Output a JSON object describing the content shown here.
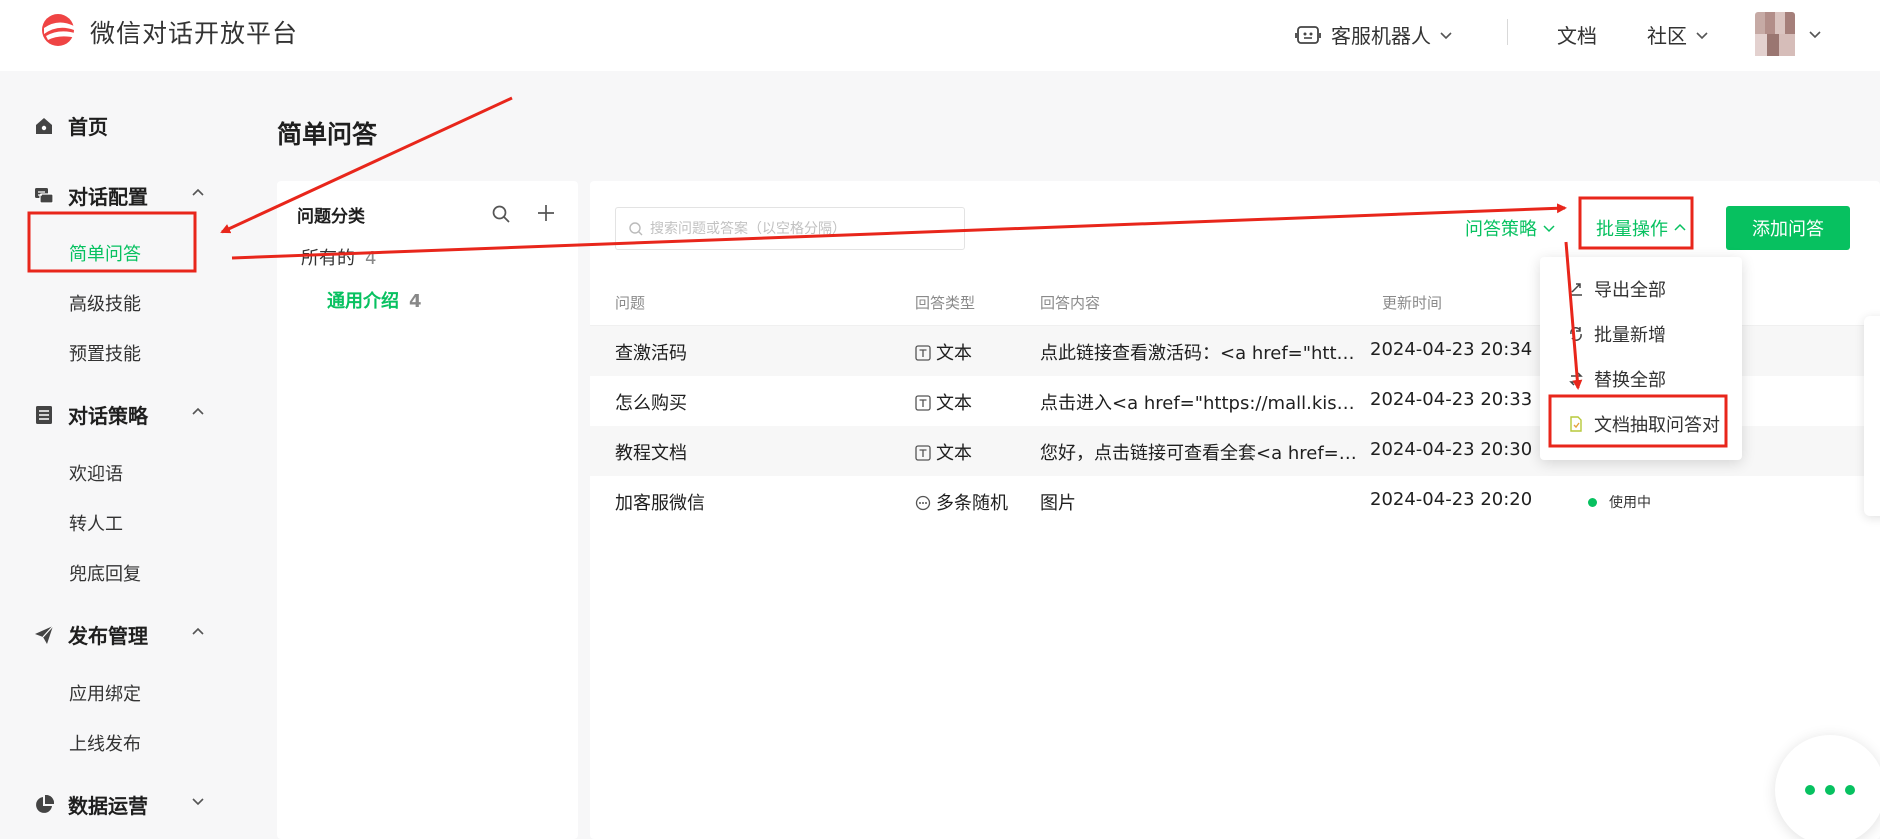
{
  "header": {
    "brand": "微信对话开放平台",
    "bot_menu": "客服机器人",
    "docs": "文档",
    "community": "社区"
  },
  "sidebar": {
    "home": "首页",
    "dialog_config": {
      "label": "对话配置",
      "items": [
        "简单问答",
        "高级技能",
        "预置技能"
      ]
    },
    "dialog_strategy": {
      "label": "对话策略",
      "items": [
        "欢迎语",
        "转人工",
        "兜底回复"
      ]
    },
    "publish": {
      "label": "发布管理",
      "items": [
        "应用绑定",
        "上线发布"
      ]
    },
    "data_ops": {
      "label": "数据运营"
    }
  },
  "page_title": "简单问答",
  "categories": {
    "title": "问题分类",
    "all_label": "所有的",
    "all_count": "4",
    "items": [
      {
        "label": "通用介绍",
        "count": "4"
      }
    ]
  },
  "toolbar": {
    "search_placeholder": "搜索问题或答案（以空格分隔）",
    "strategy": "问答策略",
    "batch": "批量操作",
    "add": "添加问答"
  },
  "table": {
    "headers": [
      "问题",
      "回答类型",
      "回答内容",
      "更新时间"
    ],
    "rows": [
      {
        "question": "查激活码",
        "type": "文本",
        "content": "点此链接查看激活码：<a href=\"https...",
        "time": "2024-04-23 20:34"
      },
      {
        "question": "怎么购买",
        "type": "文本",
        "content": "点击进入<a href=\"https://mall.kissfr...",
        "time": "2024-04-23 20:33"
      },
      {
        "question": "教程文档",
        "type": "文本",
        "content": "您好，点击链接可查看全套<a href=\"...",
        "time": "2024-04-23 20:30"
      },
      {
        "question": "加客服微信",
        "type": "多条随机",
        "content": "图片",
        "time": "2024-04-23 20:20",
        "status": "使用中"
      }
    ]
  },
  "dropdown": {
    "items": [
      "导出全部",
      "批量新增",
      "替换全部",
      "文档抽取问答对"
    ]
  },
  "colors": {
    "accent": "#07c160",
    "annotation": "#e8261b"
  }
}
